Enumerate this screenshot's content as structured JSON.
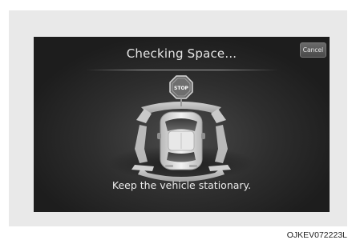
{
  "screen": {
    "title": "Checking Space...",
    "cancel_label": "Cancel",
    "stop_sign_label": "STOP",
    "message": "Keep the vehicle stationary."
  },
  "figure_code": "OJKEV072223L",
  "icons": [
    "stop-sign-icon",
    "vehicle-top-view-icon"
  ],
  "colors": {
    "screen_background": "#2e2e2e",
    "text": "#e6e6e6",
    "frame": "#e9e9e9"
  }
}
